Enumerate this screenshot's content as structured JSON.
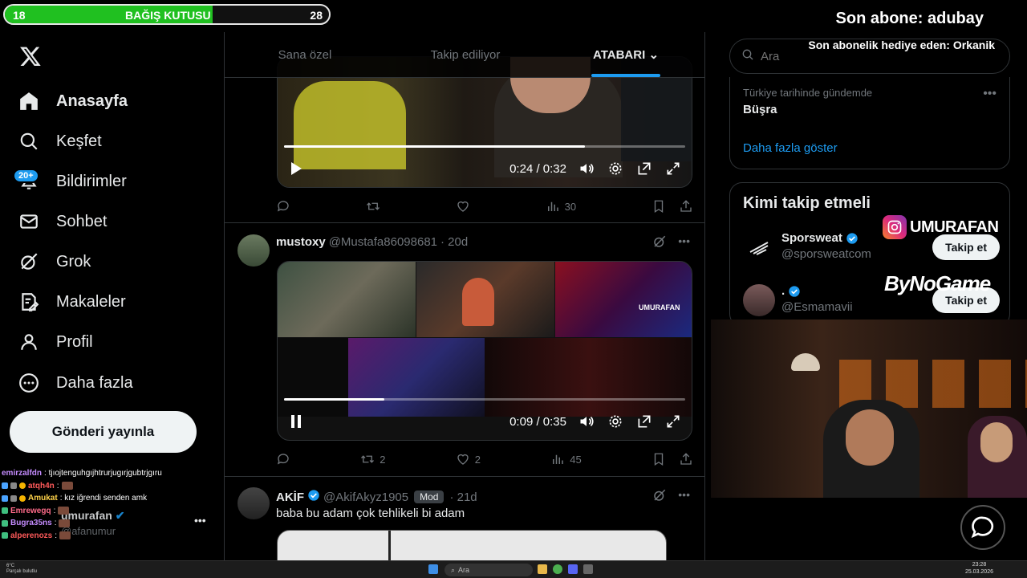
{
  "overlay": {
    "donation_left": "18",
    "donation_title": "BAĞIŞ KUTUSU",
    "donation_right": "28",
    "donation_progress": 0.64,
    "last_sub": "Son abone: adubay",
    "last_gift": "Son abonelik hediye eden: Orkanik",
    "instagram_handle": "UMURAFAN",
    "sponsor": "ByNoGame"
  },
  "sidebar": {
    "notifications_badge": "20+",
    "items": [
      {
        "label": "Anasayfa",
        "icon": "home-icon"
      },
      {
        "label": "Keşfet",
        "icon": "search-icon"
      },
      {
        "label": "Bildirimler",
        "icon": "bell-icon"
      },
      {
        "label": "Sohbet",
        "icon": "mail-icon"
      },
      {
        "label": "Grok",
        "icon": "grok-icon"
      },
      {
        "label": "Makaleler",
        "icon": "article-icon"
      },
      {
        "label": "Profil",
        "icon": "person-icon"
      },
      {
        "label": "Daha fazla",
        "icon": "more-icon"
      }
    ],
    "post_button": "Gönderi yayınla",
    "account_name": "umurafan",
    "account_handle": "@afanumur"
  },
  "chat": [
    {
      "user": "emirzalfdn",
      "message": ": tjıojtenguhgıjhtrurjugırjgubtrjgıru",
      "color": "#c58cff"
    },
    {
      "user": "atqh4n",
      "message": ":",
      "color": "#ff5a5a"
    },
    {
      "user": "Amukat",
      "message": ": kız iğrendi senden amk",
      "color": "#ffd34a"
    },
    {
      "user": "Emrewegq",
      "message": ":",
      "color": "#ff6b8a"
    },
    {
      "user": "Bugra35ns",
      "message": ":",
      "color": "#c58cff"
    },
    {
      "user": "alperenozs",
      "message": ":",
      "color": "#ff5a5a"
    }
  ],
  "feed": {
    "tabs": [
      "Sana özel",
      "Takip ediliyor",
      "ATABARI"
    ],
    "video1": {
      "time": "0:24 / 0:32",
      "progress": 0.75
    },
    "tweet1_stats": {
      "views": "30"
    },
    "tweet2": {
      "name": "mustoxy",
      "handle": "@Mustafa86098681",
      "time": "· 20d",
      "video_time": "0:09 / 0:35",
      "progress": 0.25,
      "watermark": "UMURAFAN",
      "retweets": "2",
      "likes": "2",
      "views": "45"
    },
    "tweet3": {
      "name": "AKİF",
      "handle": "@AkifAkyz1905",
      "mod": "Mod",
      "time": "· 21d",
      "text": "baba bu adam çok tehlikeli bi adam"
    }
  },
  "right": {
    "search_placeholder": "Ara",
    "trend_meta": "Türkiye tarihinde gündemde",
    "trend_name": "Büşra",
    "show_more": "Daha fazla göster",
    "follow_title": "Kimi takip etmeli",
    "suggestions": [
      {
        "name": "Sporsweat",
        "handle": "@sporsweatcom",
        "button": "Takip et"
      },
      {
        "name": ".",
        "handle": "@Esmamavii",
        "button": "Takip et"
      }
    ]
  },
  "taskbar": {
    "search": "Ara",
    "time": "23:28",
    "date": "25.03.2026",
    "weather_line1": "6°C",
    "weather_line2": "Parçalı bulutlu"
  },
  "colors": {
    "accent": "#1d9bf0",
    "donation_green": "#20c020"
  }
}
